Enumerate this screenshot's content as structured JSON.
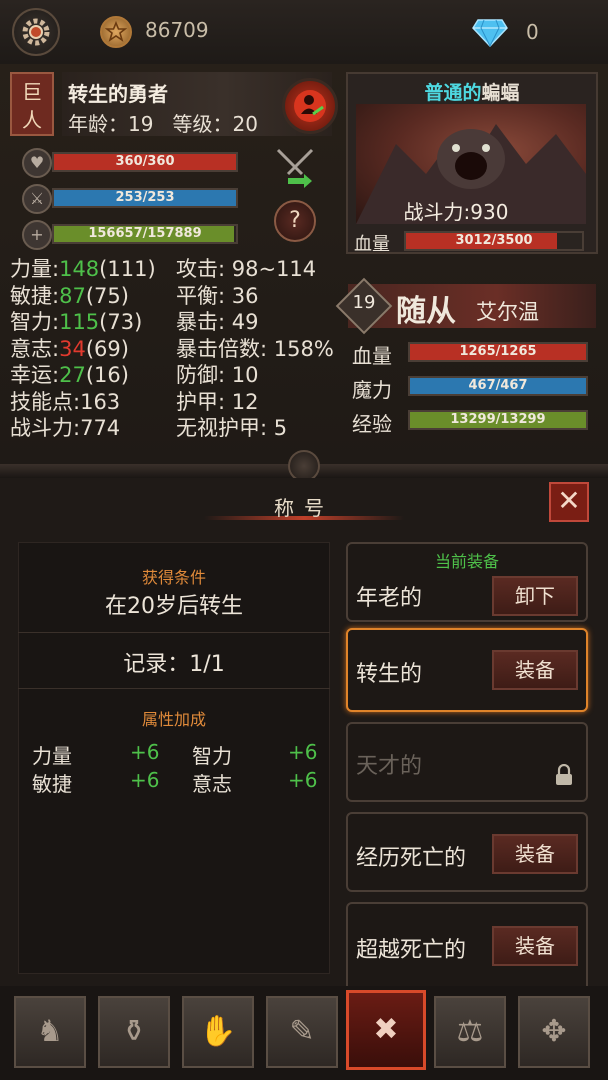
{
  "topbar": {
    "gold": "86709",
    "gems": "0"
  },
  "hero": {
    "tag_chars": [
      "巨",
      "人"
    ],
    "name": "转生的勇者",
    "age_level": "年龄：19   等级：20",
    "hp": {
      "text": "360/360",
      "fraction": 1.0,
      "color": "#b83024"
    },
    "mp": {
      "text": "253/253",
      "fraction": 1.0,
      "color": "#2c78b0"
    },
    "xp": {
      "text": "156657/157889",
      "fraction": 0.99,
      "color": "#6a8e2a"
    },
    "stats_left": [
      {
        "label": "力量:",
        "val": "148",
        "base": "(111)",
        "cls": "g"
      },
      {
        "label": "敏捷:",
        "val": "87",
        "base": "(75)",
        "cls": "g"
      },
      {
        "label": "智力:",
        "val": "115",
        "base": "(73)",
        "cls": "g"
      },
      {
        "label": "意志:",
        "val": "34",
        "base": "(69)",
        "cls": "r"
      },
      {
        "label": "幸运:",
        "val": "27",
        "base": "(16)",
        "cls": "g"
      },
      {
        "label": "技能点:",
        "val": "163",
        "base": "",
        "cls": ""
      },
      {
        "label": "战斗力:",
        "val": "774",
        "base": "",
        "cls": ""
      }
    ],
    "stats_right": [
      "攻击: 98~114",
      "平衡: 36",
      "暴击: 49",
      "暴击倍数: 158%",
      "防御: 10",
      "护甲: 12",
      "无视护甲: 5"
    ],
    "help_label": "?"
  },
  "monster": {
    "title_prefix": "普通的",
    "title_name": "蝙蝠",
    "combat_power": "战斗力:930",
    "hp_label": "血量",
    "hp": {
      "text": "3012/3500",
      "fraction": 0.86
    }
  },
  "follower": {
    "level": "19",
    "title": "随从",
    "name": "艾尔温",
    "rows": [
      {
        "label": "血量",
        "text": "1265/1265",
        "fraction": 1.0,
        "color": "#b83024"
      },
      {
        "label": "魔力",
        "text": "467/467",
        "fraction": 1.0,
        "color": "#2c78b0"
      },
      {
        "label": "经验",
        "text": "13299/13299",
        "fraction": 1.0,
        "color": "#6a8e2a"
      }
    ]
  },
  "panel": {
    "title": "称号",
    "close": "✕",
    "condition_label": "获得条件",
    "condition": "在20岁后转生",
    "record": "记录：1/1",
    "bonus_label": "属性加成",
    "bonuses": [
      {
        "name": "力量",
        "val": "+6"
      },
      {
        "name": "智力",
        "val": "+6"
      },
      {
        "name": "敏捷",
        "val": "+6"
      },
      {
        "name": "意志",
        "val": "+6"
      }
    ],
    "current_label": "当前装备",
    "slots": [
      {
        "name": "年老的",
        "button": "卸下",
        "locked": false
      },
      {
        "name": "转生的",
        "button": "装备",
        "locked": false
      },
      {
        "name": "天才的",
        "button": "",
        "locked": true
      },
      {
        "name": "经历死亡的",
        "button": "装备",
        "locked": false
      },
      {
        "name": "超越死亡的",
        "button": "装备",
        "locked": false
      }
    ]
  },
  "nav": [
    {
      "name": "character",
      "glyph": "♞"
    },
    {
      "name": "inventory",
      "glyph": "⚱"
    },
    {
      "name": "trade",
      "glyph": "✋"
    },
    {
      "name": "skills-book",
      "glyph": "✎"
    },
    {
      "name": "titles",
      "glyph": "✖"
    },
    {
      "name": "loot",
      "glyph": "⚖"
    },
    {
      "name": "map",
      "glyph": "✥"
    }
  ]
}
